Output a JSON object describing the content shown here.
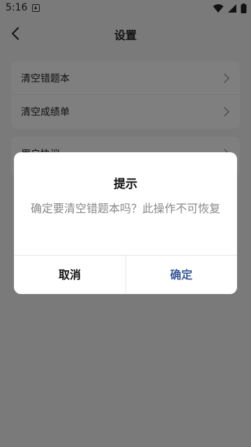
{
  "status_bar": {
    "time": "5:16"
  },
  "header": {
    "title": "设置",
    "back_icon": "chevron-left-icon"
  },
  "settings": {
    "items": [
      {
        "label": "清空错题本"
      },
      {
        "label": "清空成绩单"
      },
      {
        "label": "用户协议"
      }
    ]
  },
  "dialog": {
    "title": "提示",
    "message": "确定要清空错题本吗？此操作不可恢复",
    "cancel_label": "取消",
    "confirm_label": "确定"
  },
  "colors": {
    "confirm_accent": "#3a5a9a",
    "overlay": "rgba(0,0,0,0.5)"
  }
}
